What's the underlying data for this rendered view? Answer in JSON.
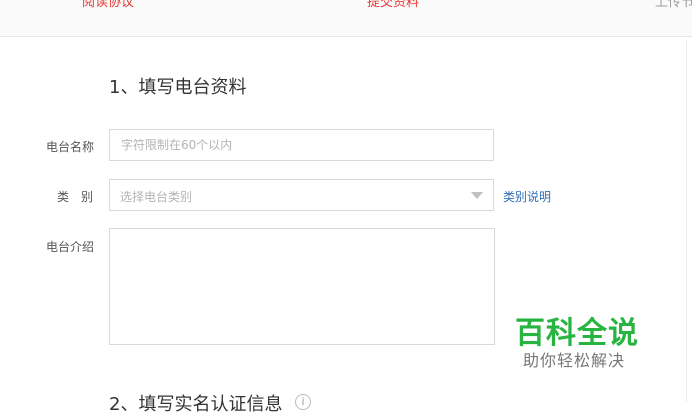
{
  "steps": {
    "step1": "阅读协议",
    "step2": "提交资料",
    "step3": "上传节"
  },
  "section1_title": "1、填写电台资料",
  "section2_title": "2、填写实名认证信息",
  "form": {
    "name_label": "电台名称",
    "name_placeholder": "字符限制在60个以内",
    "type_label": "类别",
    "type_placeholder": "选择电台类别",
    "type_help_link": "类别说明",
    "intro_label": "电台介绍",
    "intro_value": ""
  },
  "watermark": {
    "main": "百科全说",
    "sub": "助你轻松解决"
  },
  "colors": {
    "active_step": "#e53935",
    "link": "#2d6fb8",
    "watermark_green": "#27b441"
  },
  "icons": {
    "select_caret": "chevron-down-icon",
    "info": "info-icon"
  }
}
